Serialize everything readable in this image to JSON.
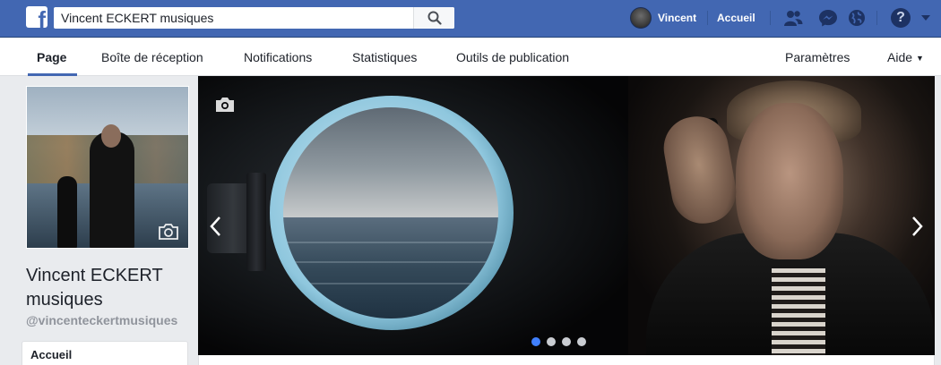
{
  "topbar": {
    "search": {
      "value": "Vincent ECKERT musiques",
      "placeholder": ""
    },
    "user_name": "Vincent",
    "home_label": "Accueil",
    "icons": [
      "friend-requests-icon",
      "messenger-icon",
      "notifications-globe-icon",
      "help-icon"
    ],
    "brand_color": "#4267b2"
  },
  "pagenav": {
    "tabs": [
      {
        "label": "Page",
        "active": true
      },
      {
        "label": "Boîte de réception"
      },
      {
        "label": "Notifications"
      },
      {
        "label": "Statistiques"
      },
      {
        "label": "Outils de publication"
      }
    ],
    "settings_label": "Paramètres",
    "help_label": "Aide"
  },
  "page": {
    "name": "Vincent ECKERT musiques",
    "handle": "@vincenteckertmusiques",
    "menu": [
      {
        "label": "Accueil"
      }
    ]
  },
  "cover": {
    "slides": 4,
    "active_slide": 1,
    "active_dot_color": "#4080ff"
  }
}
